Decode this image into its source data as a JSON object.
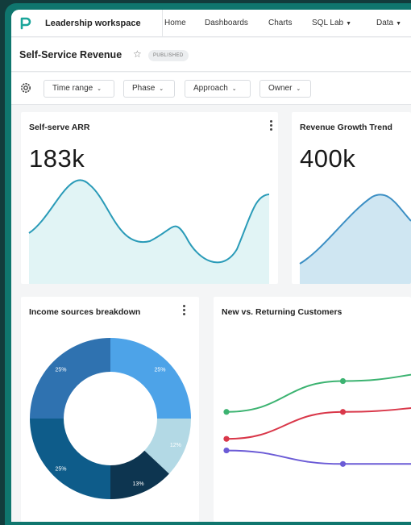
{
  "colors": {
    "frame": "#0f766e",
    "accent": "#20a7c9",
    "green": "#3cb371",
    "red": "#d9384a",
    "purple": "#6b5bd6"
  },
  "nav": {
    "workspace": "Leadership workspace",
    "links": [
      "Home",
      "Dashboards",
      "Charts",
      "SQL Lab",
      "Data"
    ],
    "dropdown_links": [
      "SQL Lab",
      "Data"
    ]
  },
  "dashboard": {
    "title": "Self-Service Revenue",
    "status": "PUBLISHED"
  },
  "filters": [
    "Time range",
    "Phase",
    "Approach",
    "Owner"
  ],
  "cards": {
    "arr": {
      "title": "Self-serve ARR",
      "value": "183k"
    },
    "growth": {
      "title": "Revenue Growth Trend",
      "value": "400k"
    },
    "income": {
      "title": "Income sources breakdown"
    },
    "customers": {
      "title": "New vs. Returning Customers"
    }
  },
  "chart_data": [
    {
      "type": "pie",
      "title": "Income sources breakdown",
      "donut": true,
      "slices": [
        {
          "label": "25%",
          "value": 25,
          "color": "#4da3e8"
        },
        {
          "label": "12%",
          "value": 12,
          "color": "#b3d9e5"
        },
        {
          "label": "13%",
          "value": 13,
          "color": "#0d3550"
        },
        {
          "label": "25%",
          "value": 25,
          "color": "#0e5c8a"
        },
        {
          "label": "25%",
          "value": 25,
          "color": "#2f72b0"
        }
      ]
    },
    {
      "type": "line",
      "title": "New vs. Returning Customers",
      "x": [
        0,
        1,
        2
      ],
      "series": [
        {
          "values": [
            0.57,
            0.73,
            0.78
          ],
          "color": "#3cb371"
        },
        {
          "values": [
            0.43,
            0.57,
            0.6
          ],
          "color": "#d9384a"
        },
        {
          "values": [
            0.37,
            0.3,
            0.3
          ],
          "color": "#6b5bd6"
        }
      ],
      "ylim": [
        0,
        1
      ]
    }
  ]
}
